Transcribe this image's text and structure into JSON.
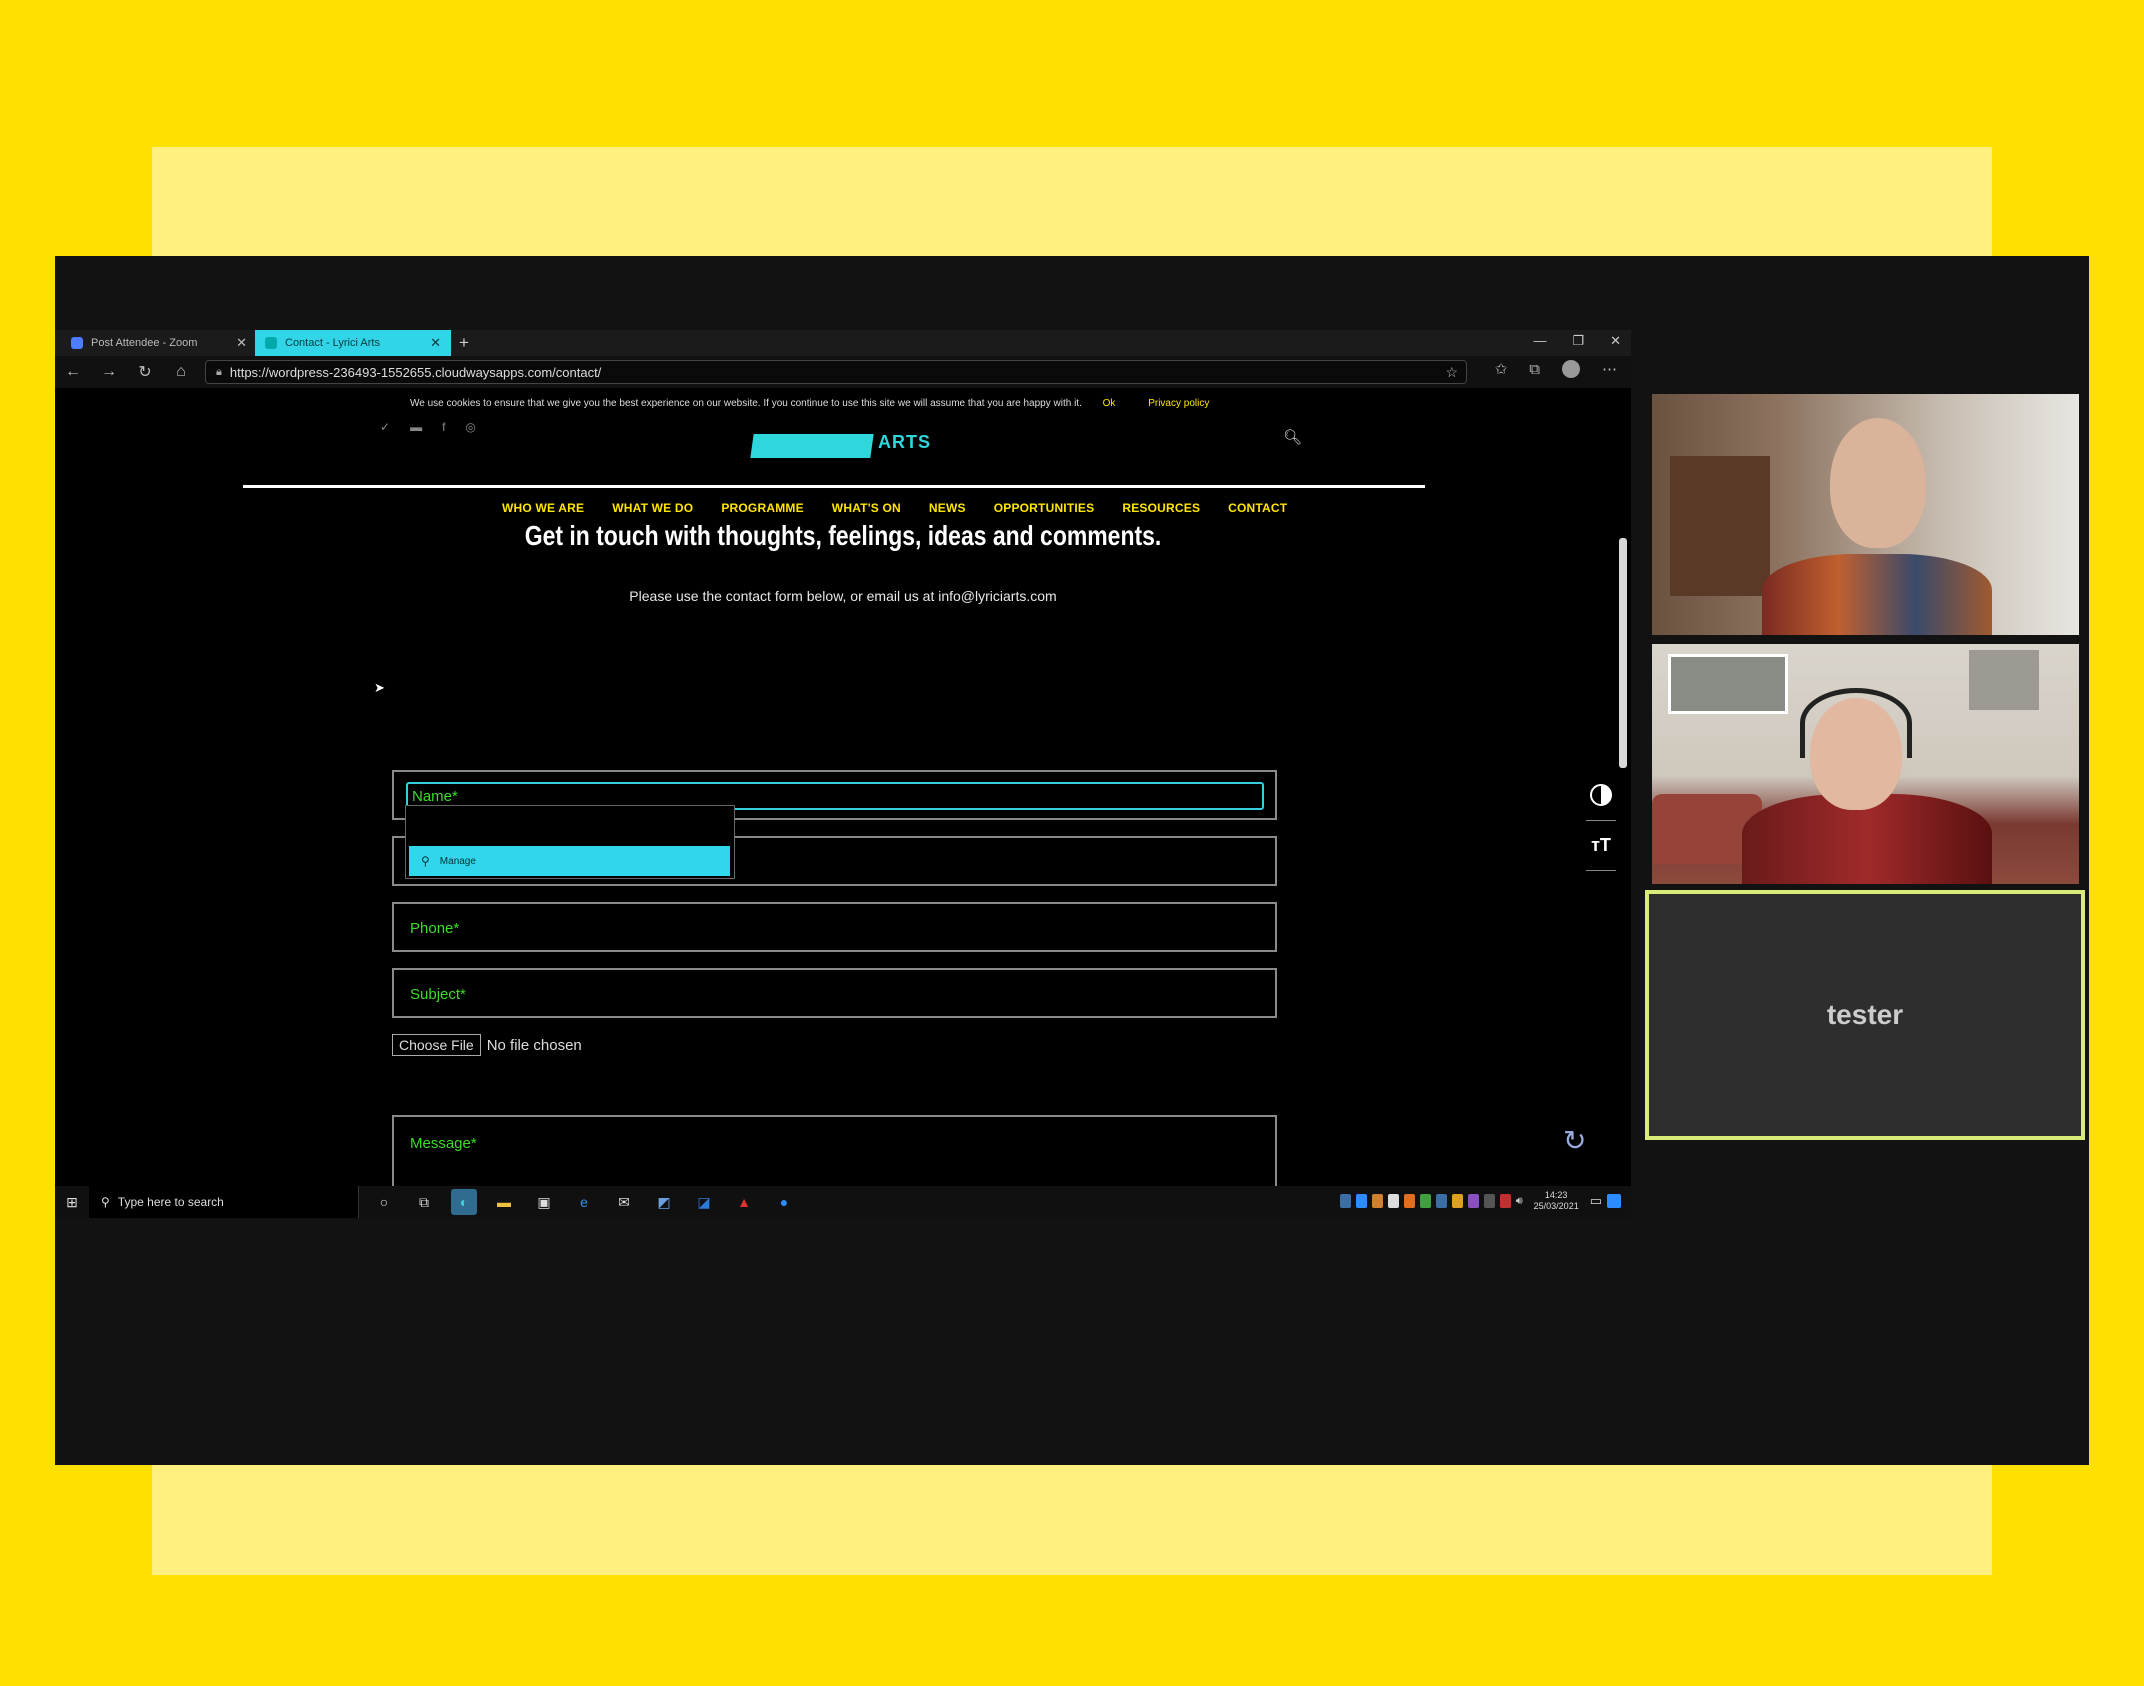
{
  "browser": {
    "tabs": [
      {
        "label": "Post Attendee - Zoom",
        "active": false
      },
      {
        "label": "Contact - Lyrici Arts",
        "active": true
      }
    ],
    "url": "https://wordpress-236493-1552655.cloudwaysapps.com/contact/"
  },
  "site": {
    "cookie": {
      "text": "We use cookies to ensure that we give you the best experience on our website. If you continue to use this site we will assume that you are happy with it.",
      "ok": "Ok",
      "privacy": "Privacy policy"
    },
    "logo_text": "ARTS",
    "menu": [
      "WHO WE ARE",
      "WHAT WE DO",
      "PROGRAMME",
      "WHAT'S ON",
      "NEWS",
      "OPPORTUNITIES",
      "RESOURCES",
      "CONTACT"
    ],
    "heading": "Get in touch with thoughts, feelings, ideas and comments.",
    "subtext": "Please use the contact form below, or email us at info@lyriciarts.com",
    "form": {
      "name_placeholder": "Name*",
      "phone_placeholder": "Phone*",
      "subject_placeholder": "Subject*",
      "message_placeholder": "Message*",
      "autofill_option": "Manage",
      "file_button": "Choose File",
      "file_status": "No file chosen"
    }
  },
  "taskbar": {
    "search_placeholder": "Type here to search",
    "time": "14:23",
    "date": "25/03/2021"
  },
  "participants": {
    "tester_name": "tester"
  },
  "colors": {
    "background": "#ffe000",
    "accent": "#32d6ec",
    "menu": "#ffe600",
    "placeholder": "#3ddc2a"
  }
}
